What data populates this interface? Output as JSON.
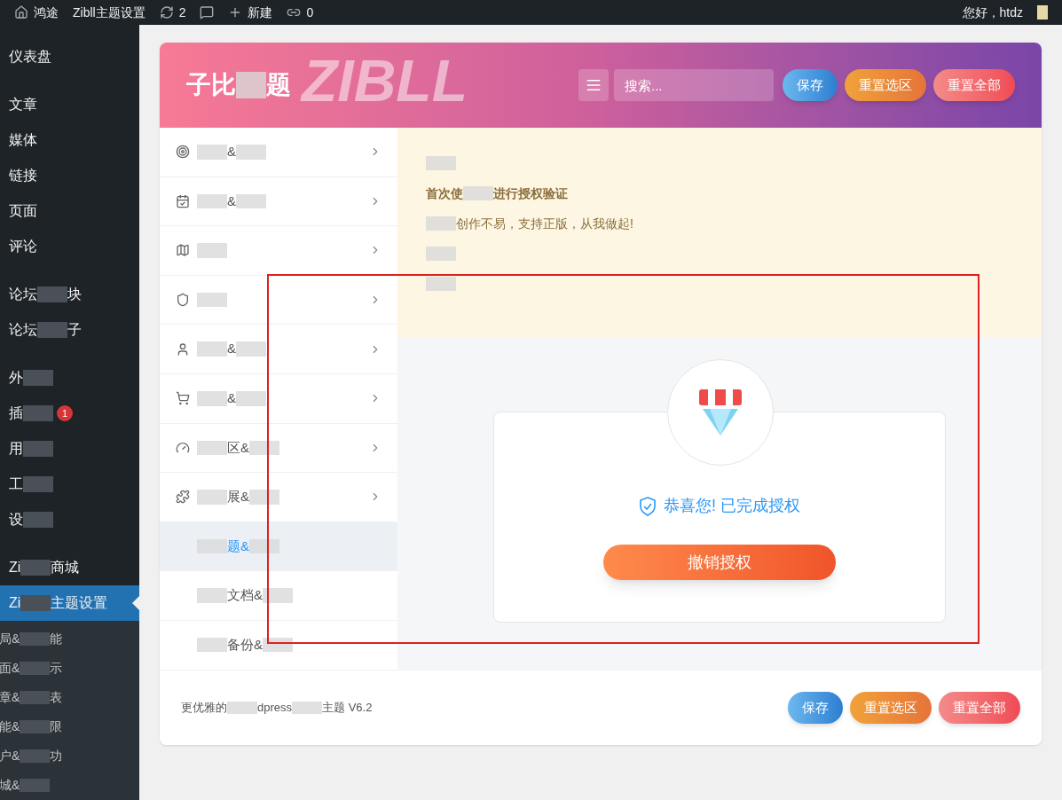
{
  "top_bar": {
    "items": [
      {
        "kind": "home",
        "label": "鸿途"
      },
      {
        "kind": "text",
        "label": "Zibll主题设置"
      },
      {
        "kind": "updates",
        "label": "2"
      },
      {
        "kind": "comments"
      },
      {
        "kind": "new",
        "label": "新建"
      },
      {
        "kind": "link",
        "label": "0"
      }
    ],
    "greeting": "您好，htdz"
  },
  "sidebar": {
    "groups": [
      [
        {
          "segments": [
            {
              "kind": "text",
              "text": "仪表盘"
            }
          ],
          "selected": false
        }
      ],
      [
        {
          "segments": [
            {
              "kind": "text",
              "text": "文章"
            }
          ],
          "selected": false
        },
        {
          "segments": [
            {
              "kind": "text",
              "text": "媒体"
            }
          ],
          "selected": false
        },
        {
          "segments": [
            {
              "kind": "text",
              "text": "链接"
            }
          ],
          "selected": false
        },
        {
          "segments": [
            {
              "kind": "text",
              "text": "页面"
            }
          ],
          "selected": false
        },
        {
          "segments": [
            {
              "kind": "text",
              "text": "评论"
            }
          ],
          "selected": false
        }
      ],
      [
        {
          "segments": [
            {
              "kind": "text",
              "text": "论坛"
            },
            {
              "kind": "redacted"
            },
            {
              "kind": "text",
              "text": "块"
            }
          ],
          "selected": false
        },
        {
          "segments": [
            {
              "kind": "text",
              "text": "论坛"
            },
            {
              "kind": "redacted"
            },
            {
              "kind": "text",
              "text": "子"
            }
          ],
          "selected": false
        }
      ],
      [
        {
          "segments": [
            {
              "kind": "text",
              "text": "外"
            },
            {
              "kind": "redacted"
            }
          ],
          "selected": false
        },
        {
          "segments": [
            {
              "kind": "text",
              "text": "插"
            },
            {
              "kind": "redacted"
            }
          ],
          "selected": false,
          "badge": "1"
        },
        {
          "segments": [
            {
              "kind": "text",
              "text": "用"
            },
            {
              "kind": "redacted"
            }
          ],
          "selected": false
        },
        {
          "segments": [
            {
              "kind": "text",
              "text": "工"
            },
            {
              "kind": "redacted"
            }
          ],
          "selected": false
        },
        {
          "segments": [
            {
              "kind": "text",
              "text": "设"
            },
            {
              "kind": "redacted"
            }
          ],
          "selected": false
        }
      ],
      [
        {
          "segments": [
            {
              "kind": "text",
              "text": "Zi"
            },
            {
              "kind": "redacted"
            },
            {
              "kind": "text",
              "text": "商城"
            }
          ],
          "selected": false
        },
        {
          "segments": [
            {
              "kind": "text",
              "text": "Zi"
            },
            {
              "kind": "redacted"
            },
            {
              "kind": "text",
              "text": "主题设置"
            }
          ],
          "selected": true
        }
      ]
    ],
    "submenu": [
      [
        {
          "kind": "text",
          "text": "局&"
        },
        {
          "kind": "redacted"
        },
        {
          "kind": "text",
          "text": "能"
        }
      ],
      [
        {
          "kind": "text",
          "text": "面&"
        },
        {
          "kind": "redacted"
        },
        {
          "kind": "text",
          "text": "示"
        }
      ],
      [
        {
          "kind": "text",
          "text": "章&"
        },
        {
          "kind": "redacted"
        },
        {
          "kind": "text",
          "text": "表"
        }
      ],
      [
        {
          "kind": "text",
          "text": "能&"
        },
        {
          "kind": "redacted"
        },
        {
          "kind": "text",
          "text": "限"
        }
      ],
      [
        {
          "kind": "text",
          "text": "户&"
        },
        {
          "kind": "redacted"
        },
        {
          "kind": "text",
          "text": "功"
        }
      ],
      [
        {
          "kind": "text",
          "text": "城&"
        },
        {
          "kind": "redacted"
        }
      ]
    ]
  },
  "header": {
    "title": [
      {
        "kind": "text",
        "text": "子比"
      },
      {
        "kind": "redacted"
      },
      {
        "kind": "text",
        "text": "题"
      }
    ],
    "watermark": "ZIBLL",
    "search": {
      "placeholder": "搜索..."
    },
    "buttons": [
      {
        "kind": "blue",
        "label": "保存"
      },
      {
        "kind": "orange",
        "label": "重置选区"
      },
      {
        "kind": "red",
        "label": "重置全部"
      }
    ]
  },
  "nav": [
    {
      "segments": [
        {
          "kind": "redacted"
        },
        {
          "kind": "text",
          "text": "&"
        },
        {
          "kind": "redacted"
        }
      ],
      "expandable": true,
      "selected": false
    },
    {
      "segments": [
        {
          "kind": "redacted"
        },
        {
          "kind": "text",
          "text": "&"
        },
        {
          "kind": "redacted"
        }
      ],
      "expandable": true,
      "selected": false
    },
    {
      "segments": [
        {
          "kind": "redacted"
        }
      ],
      "expandable": true,
      "selected": false
    },
    {
      "segments": [
        {
          "kind": "redacted"
        }
      ],
      "expandable": true,
      "selected": false
    },
    {
      "segments": [
        {
          "kind": "redacted"
        },
        {
          "kind": "text",
          "text": "&"
        },
        {
          "kind": "redacted"
        }
      ],
      "expandable": true,
      "selected": false
    },
    {
      "segments": [
        {
          "kind": "redacted"
        },
        {
          "kind": "text",
          "text": "&"
        },
        {
          "kind": "redacted"
        }
      ],
      "expandable": true,
      "selected": false
    },
    {
      "segments": [
        {
          "kind": "redacted"
        },
        {
          "kind": "text",
          "text": "区&"
        },
        {
          "kind": "redacted"
        }
      ],
      "expandable": true,
      "selected": false
    },
    {
      "segments": [
        {
          "kind": "redacted"
        },
        {
          "kind": "text",
          "text": "展&"
        },
        {
          "kind": "redacted"
        }
      ],
      "expandable": true,
      "selected": false
    },
    {
      "segments": [
        {
          "kind": "redacted"
        },
        {
          "kind": "text",
          "text": "题&"
        },
        {
          "kind": "redacted"
        }
      ],
      "expandable": false,
      "selected": true
    },
    {
      "segments": [
        {
          "kind": "redacted"
        },
        {
          "kind": "text",
          "text": "文档&"
        },
        {
          "kind": "redacted"
        }
      ],
      "expandable": false,
      "selected": false
    },
    {
      "segments": [
        {
          "kind": "redacted"
        },
        {
          "kind": "text",
          "text": "备份&"
        },
        {
          "kind": "redacted"
        }
      ],
      "expandable": false,
      "selected": false
    }
  ],
  "notice": {
    "lines": [
      [
        {
          "kind": "redacted"
        }
      ],
      [
        {
          "kind": "bold",
          "text": "首次使"
        },
        {
          "kind": "redacted"
        },
        {
          "kind": "bold",
          "text": "进行授权验证"
        }
      ],
      [
        {
          "kind": "redacted"
        },
        {
          "kind": "text",
          "text": "创作不易，支持正版，从我做起!"
        }
      ],
      [
        {
          "kind": "redacted"
        }
      ],
      [
        {
          "kind": "redacted"
        }
      ]
    ]
  },
  "license_card": {
    "status": "恭喜您! 已完成授权",
    "button": "撤销授权"
  },
  "footer": {
    "segments": [
      {
        "kind": "text",
        "text": "更优雅的"
      },
      {
        "kind": "redacted"
      },
      {
        "kind": "text",
        "text": "dpress"
      },
      {
        "kind": "redacted"
      },
      {
        "kind": "text",
        "text": "主题 V6.2"
      }
    ],
    "buttons": [
      {
        "kind": "blue",
        "label": "保存"
      },
      {
        "kind": "orange",
        "label": "重置选区"
      },
      {
        "kind": "red",
        "label": "重置全部"
      }
    ]
  },
  "annotation": {
    "kind": "red-frame"
  }
}
